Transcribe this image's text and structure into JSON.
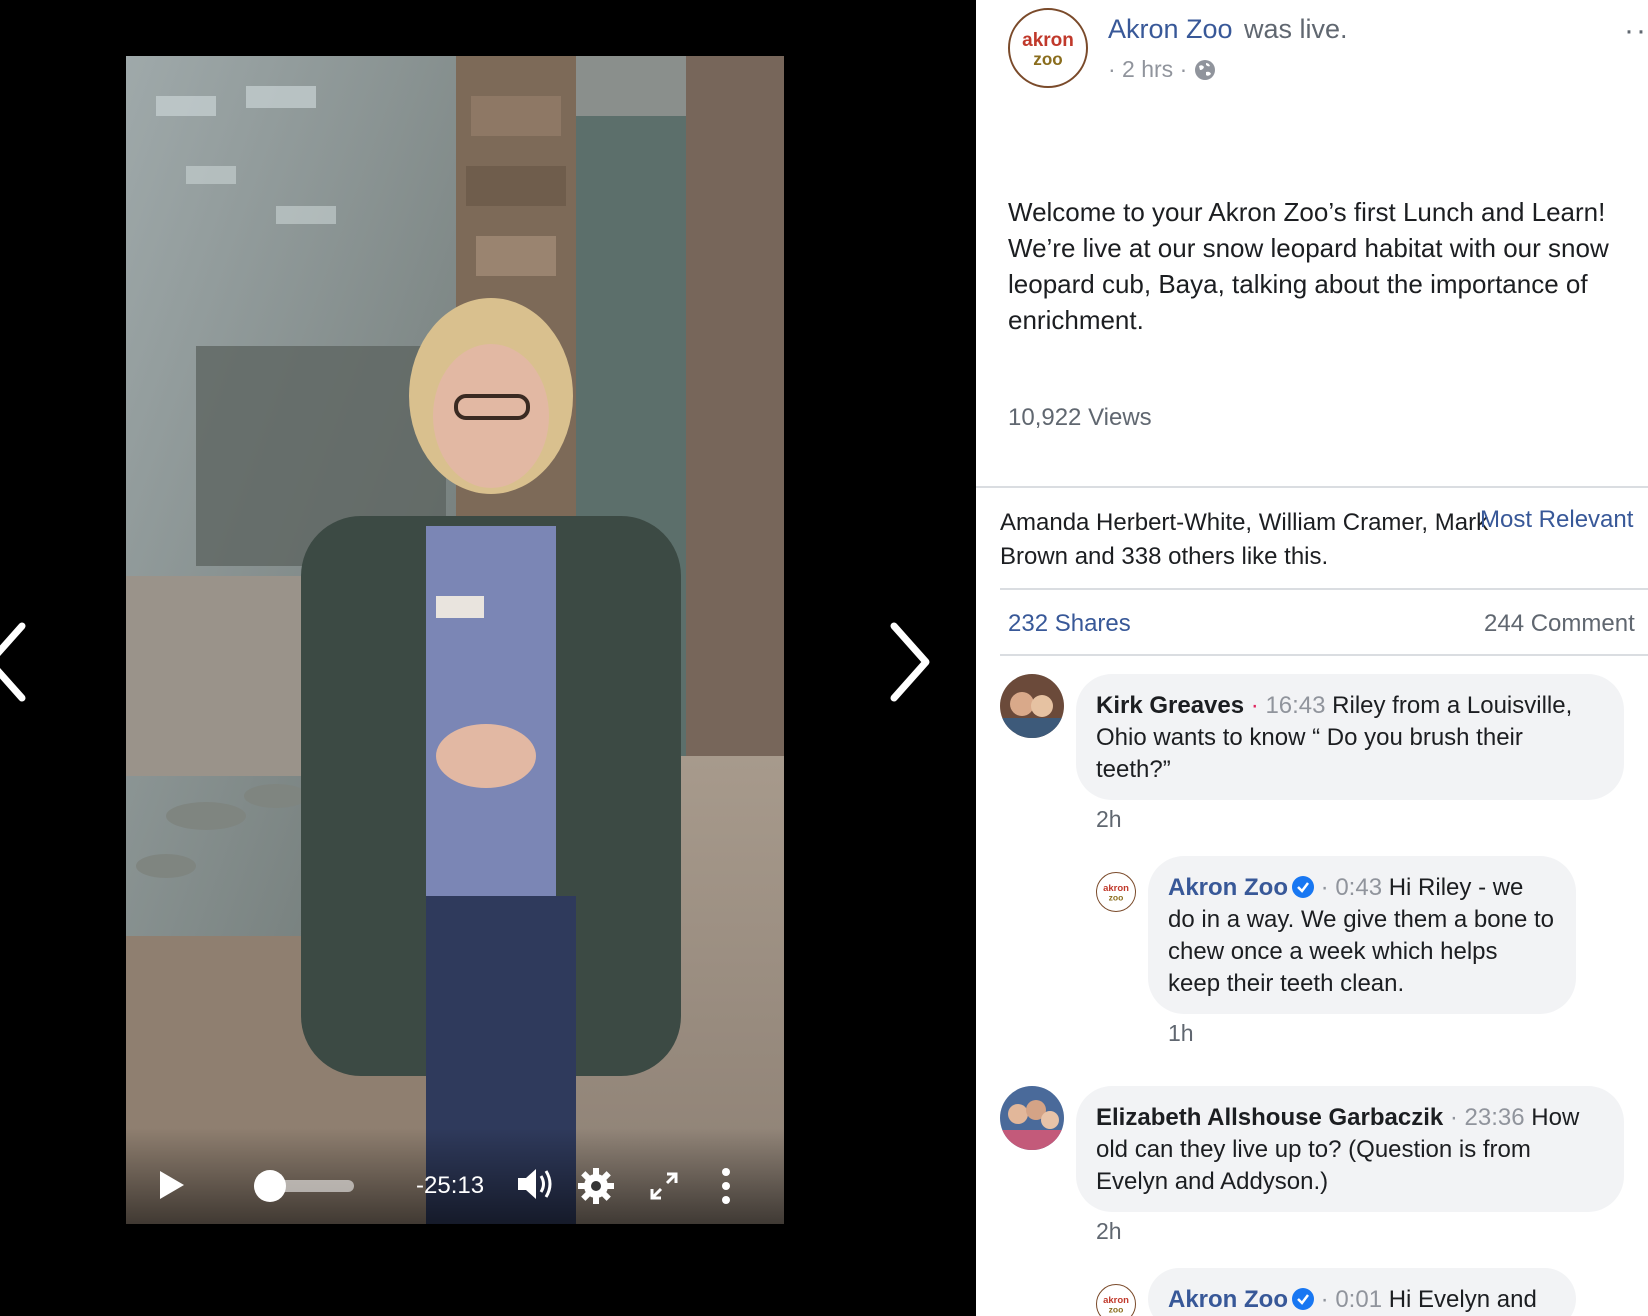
{
  "video": {
    "time_remaining": "-25:13",
    "progress_fraction": 0.0
  },
  "post": {
    "page_name": "Akron Zoo",
    "status": "was live.",
    "meta_time": "· 2 hrs ·",
    "options": "··",
    "text": "Welcome to your Akron Zoo’s first Lunch and Learn! We’re live at our snow leopard habitat with our snow leopard cub, Baya, talking about the importance of enrichment.",
    "views": "10,922 Views",
    "likes_text": "Amanda Herbert-White, William Cramer, Mark Brown and 338 others like this.",
    "sort_label": "Most Relevant",
    "shares": "232 Shares",
    "comments_count": "244 Comment",
    "logo_text": [
      "akron",
      "zoo"
    ]
  },
  "comments": [
    {
      "author": "Kirk Greaves",
      "sep": " · ",
      "timestamp": "16:43",
      "text": "Riley from a Louisville, Ohio wants to know “ Do you brush their teeth?”",
      "age": "2h"
    },
    {
      "author": "Akron Zoo",
      "sep": " · ",
      "timestamp": "0:43",
      "text": "Hi Riley - we do in a way. We give them a bone to chew once a week which helps keep their teeth clean.",
      "age": "1h"
    },
    {
      "author": "Elizabeth Allshouse Garbaczik",
      "sep": " · ",
      "timestamp": "23:36",
      "text": "How old can they live up to? (Question is from Evelyn and Addyson.)",
      "age": "2h"
    },
    {
      "author": "Akron Zoo",
      "sep": " · ",
      "timestamp": "0:01",
      "text": "Hi Evelyn and",
      "age": ""
    }
  ],
  "colors": {
    "link": "#385898",
    "verified": "#1877f2",
    "live_dot": "#e0245e",
    "bubble": "#f2f3f5"
  }
}
